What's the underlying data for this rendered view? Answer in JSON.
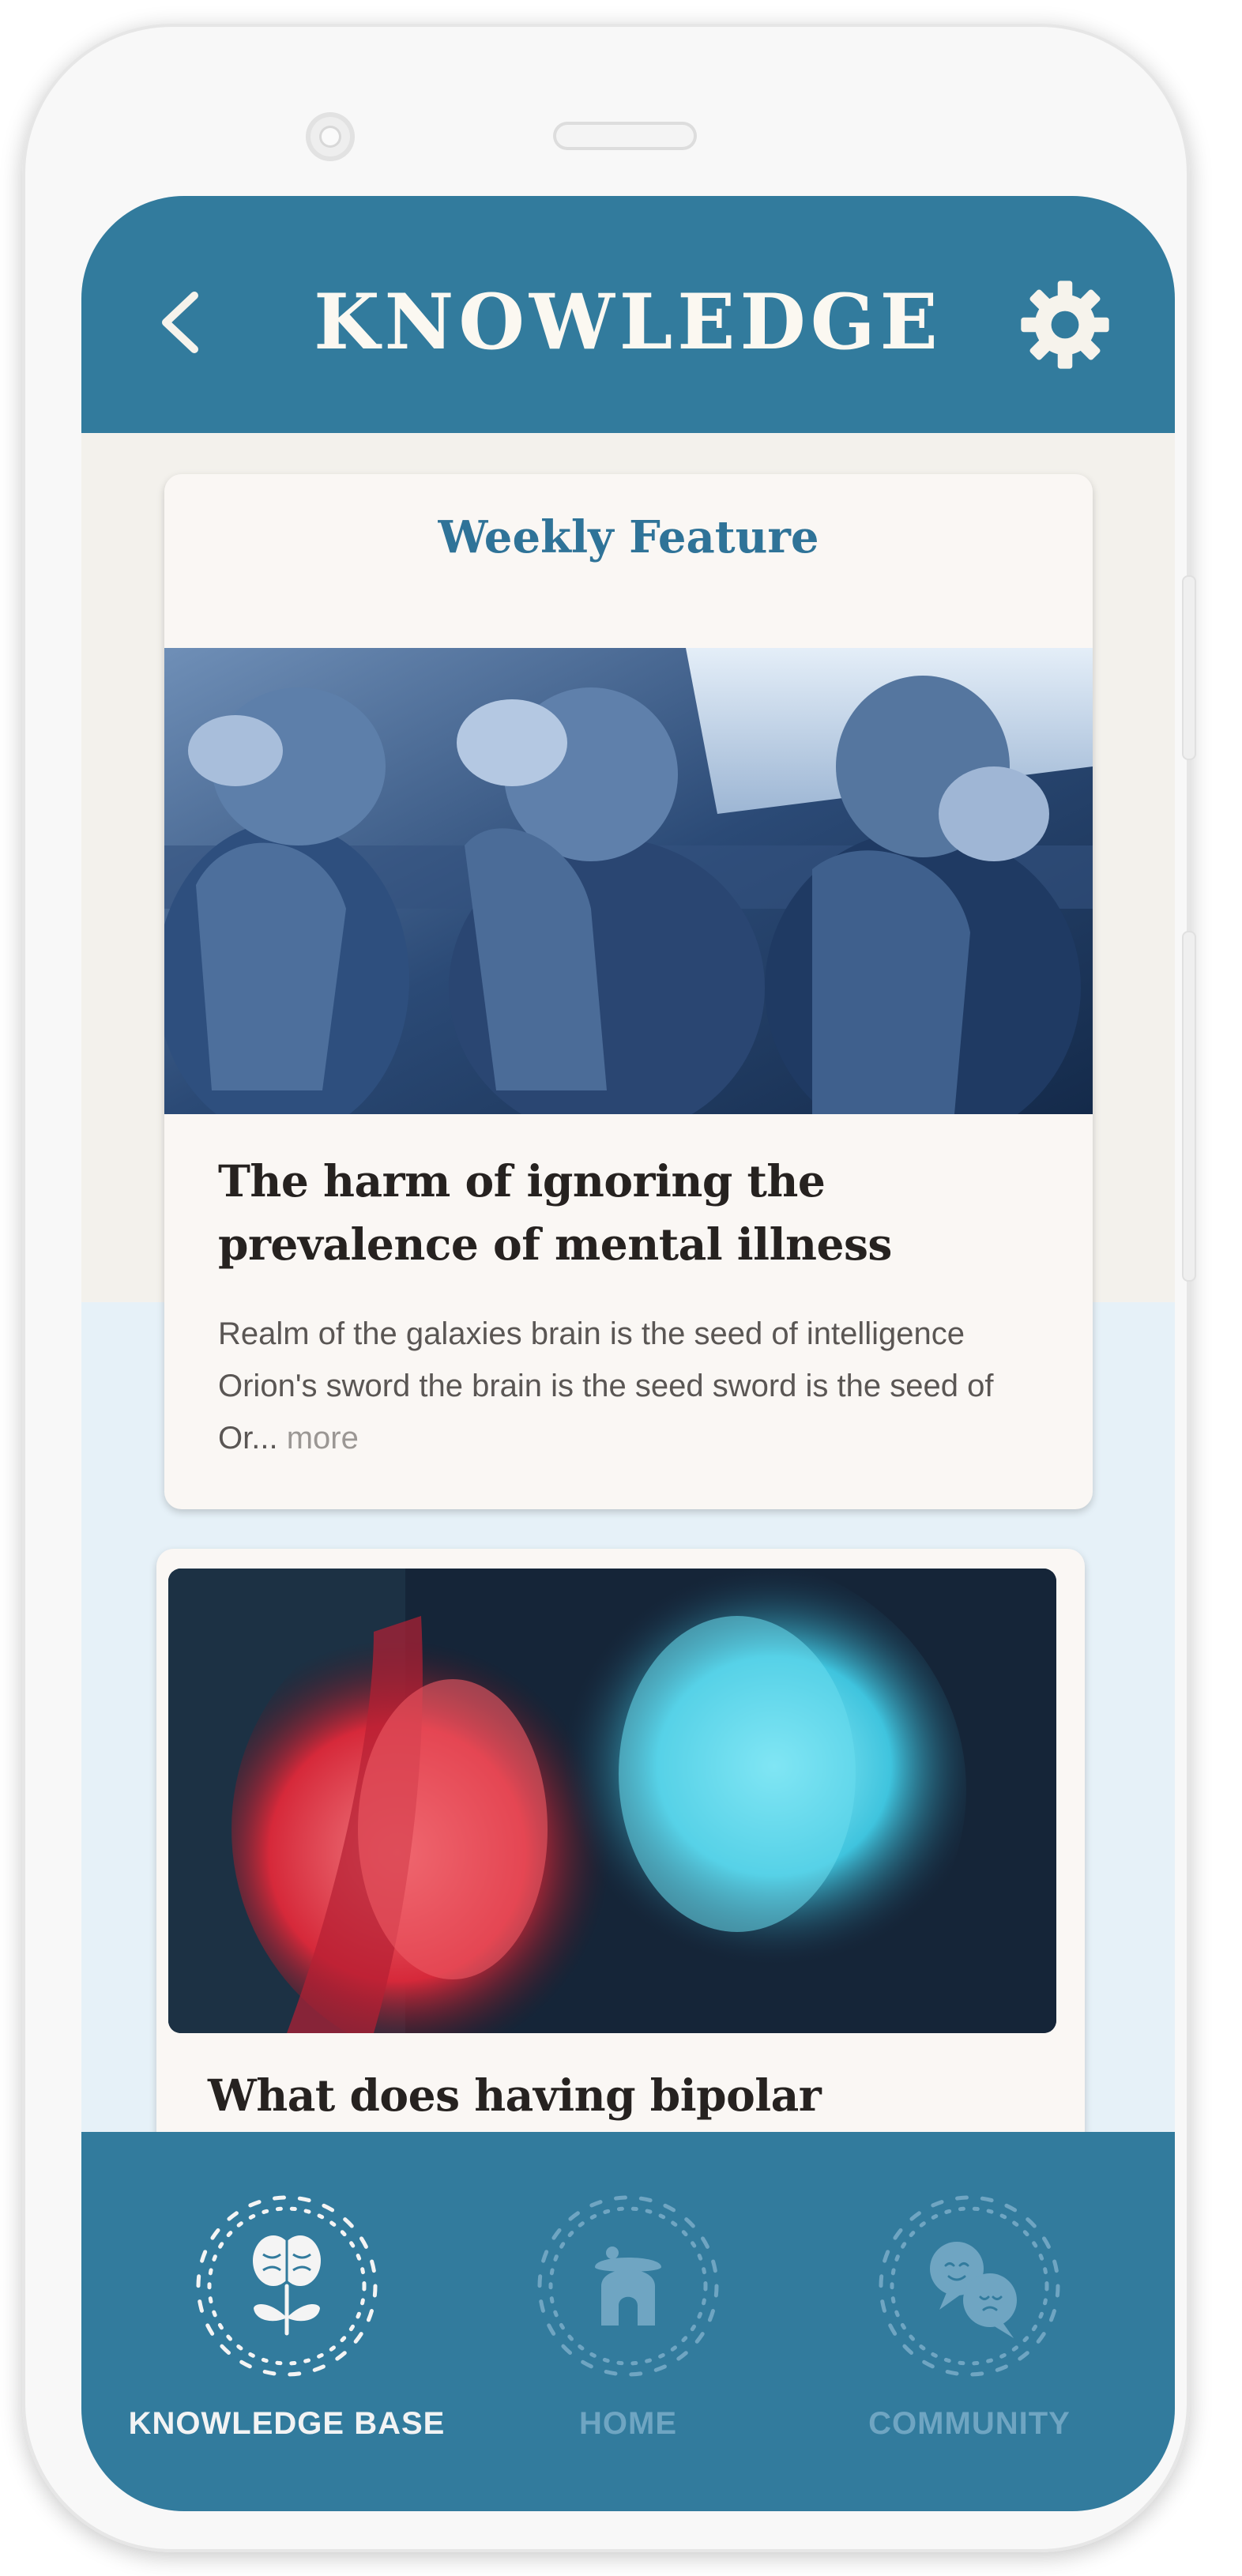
{
  "header": {
    "title": "KNOWLEDGE",
    "back_icon": "chevron-left-icon",
    "settings_icon": "gear-icon"
  },
  "featured": {
    "label": "Weekly Feature",
    "title": "The harm of ignoring the prevalence of mental illness",
    "excerpt": "Realm of the galaxies brain is the seed of intelligence Orion's sword the brain is the seed sword is the seed of Or...",
    "more": "more"
  },
  "articles": [
    {
      "title": "What does having bipolar"
    }
  ],
  "nav": {
    "items": [
      {
        "label": "KNOWLEDGE BASE",
        "icon": "brain-plant-icon",
        "active": true
      },
      {
        "label": "HOME",
        "icon": "home-icon",
        "active": false
      },
      {
        "label": "COMMUNITY",
        "icon": "chat-bubbles-icon",
        "active": false
      }
    ]
  },
  "colors": {
    "primary": "#327b9d",
    "cream": "#faf7f4",
    "light_blue": "#e6f1f8",
    "nav_inactive": "#6fa5c2"
  }
}
